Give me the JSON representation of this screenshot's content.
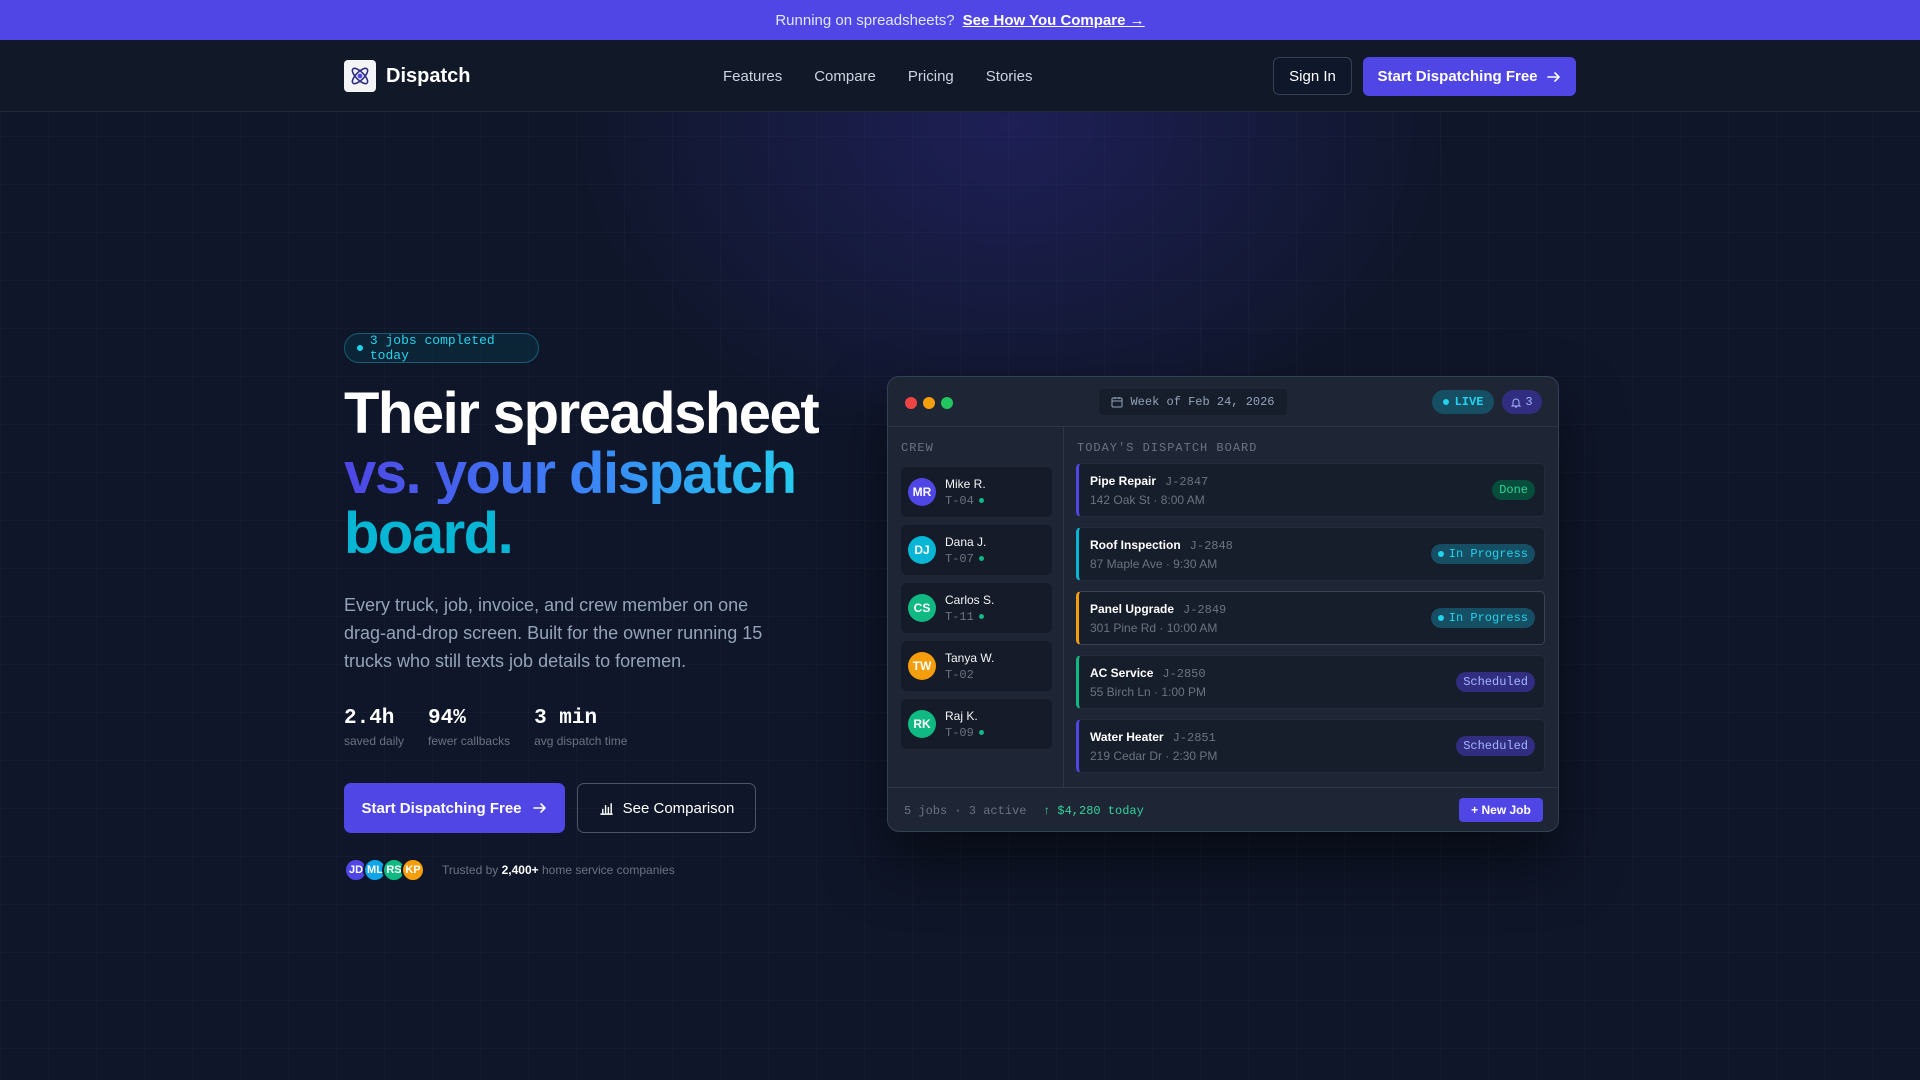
{
  "announcement": {
    "text": "Running on spreadsheets?",
    "link": "See How You Compare →"
  },
  "nav": {
    "brand": "Dispatch",
    "links": [
      "Features",
      "Compare",
      "Pricing",
      "Stories"
    ],
    "sign_in": "Sign In",
    "cta": "Start Dispatching Free"
  },
  "hero": {
    "pill": "3 jobs completed today",
    "headline_line1": "Their spreadsheet",
    "headline_line2": "vs. your dispatch",
    "headline_line3": "board.",
    "subhead": "Every truck, job, invoice, and crew member on one drag-and-drop screen. Built for the owner running 15 trucks who still texts job details to foremen.",
    "stats": [
      {
        "value": "2.4h",
        "label": "saved daily"
      },
      {
        "value": "94%",
        "label": "fewer callbacks"
      },
      {
        "value": "3 min",
        "label": "avg dispatch time"
      }
    ],
    "cta_primary": "Start Dispatching Free",
    "cta_secondary": "See Comparison",
    "trusted_avatars": [
      {
        "initials": "JD",
        "color": "#4f46e5"
      },
      {
        "initials": "ML",
        "color": "#0ea5e9"
      },
      {
        "initials": "RS",
        "color": "#10b981"
      },
      {
        "initials": "KP",
        "color": "#f59e0b"
      }
    ],
    "trusted_prefix": "Trusted by",
    "trusted_count": "2,400+",
    "trusted_suffix": "home service companies"
  },
  "panel": {
    "week": "Week of Feb 24, 2026",
    "live": "LIVE",
    "notifications": "3",
    "crew_label": "CREW",
    "board_label": "TODAY'S DISPATCH BOARD",
    "crew": [
      {
        "initials": "MR",
        "name": "Mike R.",
        "truck": "T-04",
        "color": "#4f46e5",
        "online": true
      },
      {
        "initials": "DJ",
        "name": "Dana J.",
        "truck": "T-07",
        "color": "#06b6d4",
        "online": true
      },
      {
        "initials": "CS",
        "name": "Carlos S.",
        "truck": "T-11",
        "color": "#10b981",
        "online": true
      },
      {
        "initials": "TW",
        "name": "Tanya W.",
        "truck": "T-02",
        "color": "#f59e0b",
        "online": false
      },
      {
        "initials": "RK",
        "name": "Raj K.",
        "truck": "T-09",
        "color": "#10b981",
        "online": true
      }
    ],
    "jobs": [
      {
        "title": "Pipe Repair",
        "id": "J-2847",
        "sub": "142 Oak St · 8:00 AM",
        "status": "Done",
        "kind": "done",
        "accent": "#4f46e5"
      },
      {
        "title": "Roof Inspection",
        "id": "J-2848",
        "sub": "87 Maple Ave · 9:30 AM",
        "status": "In Progress",
        "kind": "progress",
        "accent": "#06b6d4"
      },
      {
        "title": "Panel Upgrade",
        "id": "J-2849",
        "sub": "301 Pine Rd · 10:00 AM",
        "status": "In Progress",
        "kind": "progress",
        "accent": "#f59e0b"
      },
      {
        "title": "AC Service",
        "id": "J-2850",
        "sub": "55 Birch Ln · 1:00 PM",
        "status": "Scheduled",
        "kind": "scheduled",
        "accent": "#10b981"
      },
      {
        "title": "Water Heater",
        "id": "J-2851",
        "sub": "219 Cedar Dr · 2:30 PM",
        "status": "Scheduled",
        "kind": "scheduled",
        "accent": "#4f46e5"
      }
    ],
    "footer_stats": "5 jobs · 3 active",
    "footer_revenue": "↑ $4,280 today",
    "new_job": "+ New Job"
  }
}
